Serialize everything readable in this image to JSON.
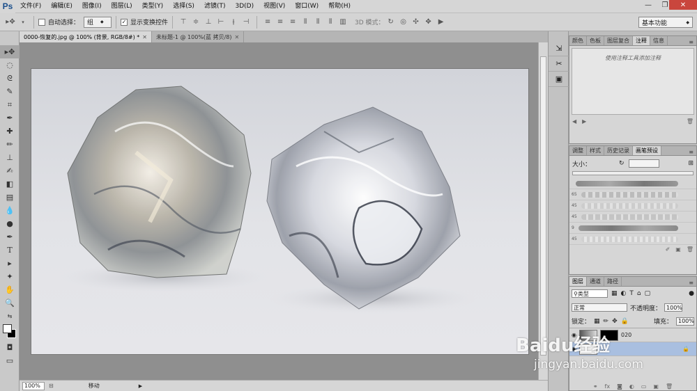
{
  "app": {
    "logo": "Ps"
  },
  "menu": [
    "文件(F)",
    "编辑(E)",
    "图像(I)",
    "图层(L)",
    "类型(Y)",
    "选择(S)",
    "滤镜(T)",
    "3D(D)",
    "视图(V)",
    "窗口(W)",
    "帮助(H)"
  ],
  "options": {
    "auto_select_label": "自动选择：",
    "auto_select_value": "组",
    "show_transform_label": "显示变换控件",
    "show_transform_checked": "✓",
    "mode_3d_label": "3D 模式：",
    "workspace": "基本功能"
  },
  "tabs": [
    {
      "label": "0000-恢复的.jpg @ 100% (背景, RGB/8#) *"
    },
    {
      "label": "未标题-1 @ 100%(蓝 拷贝/8)"
    }
  ],
  "status": {
    "zoom": "100%",
    "mode": "移动"
  },
  "panels": {
    "top_tabs": [
      "颜色",
      "色板",
      "图层复合",
      "注释",
      "信息"
    ],
    "notes_placeholder": "使用注释工具添加注释",
    "mid_tabs": [
      "调整",
      "样式",
      "历史记录",
      "画笔预设"
    ],
    "size_label": "大小：",
    "brush_sizes": [
      "",
      "65",
      "45",
      "45",
      "9",
      "45"
    ],
    "layers_tabs": [
      "图层",
      "通道",
      "路径"
    ],
    "kind_label": "类型",
    "blend_mode": "正常",
    "opacity_label": "不透明度：",
    "opacity_value": "100%",
    "lock_label": "锁定：",
    "fill_label": "填充：",
    "fill_value": "100%",
    "layers": [
      {
        "name": "020"
      },
      {
        "name": "..."
      }
    ]
  },
  "watermark": {
    "brand": "Baidu经验",
    "url": "jingyan.baidu.com"
  },
  "colors": {
    "menubar": "#d6d6d6",
    "canvas_bg": "#dcdde2",
    "panel": "#d6d6d6",
    "accent": "#1b4f8c"
  }
}
